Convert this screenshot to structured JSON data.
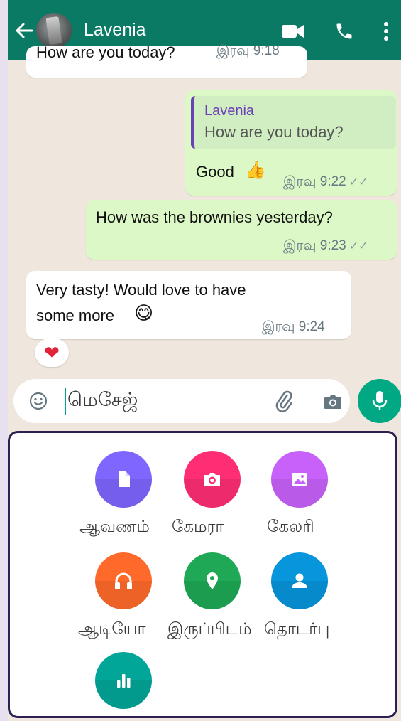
{
  "header": {
    "contact_name": "Lavenia",
    "icons": [
      "back-arrow-icon",
      "avatar",
      "video-call-icon",
      "voice-call-icon",
      "more-options-icon"
    ]
  },
  "messages": [
    {
      "direction": "in",
      "text": "How are you today?",
      "time": "இரவு 9:18"
    },
    {
      "direction": "out",
      "quote": {
        "name": "Lavenia",
        "text": "How are you today?"
      },
      "text": "Good",
      "emoji": "👍",
      "time": "இரவு 9:22"
    },
    {
      "direction": "out",
      "text": "How was the brownies yesterday?",
      "time": "இரவு 9:23"
    },
    {
      "direction": "in",
      "text_line1": "Very tasty! Would love to have",
      "text_line2": "some more",
      "emoji": "😋",
      "time": "இரவு 9:24",
      "reaction": "❤"
    }
  ],
  "composer": {
    "placeholder": "மெசேஜ்",
    "icons": [
      "emoji-icon",
      "attach-icon",
      "camera-icon",
      "mic-icon"
    ]
  },
  "attach_menu": {
    "items": [
      {
        "label": "ஆவணம்",
        "icon": "document-icon",
        "color": "#7f66ff"
      },
      {
        "label": "கேமரா",
        "icon": "camera-icon",
        "color": "#ff2e74"
      },
      {
        "label": "கேலரி",
        "icon": "gallery-icon",
        "color": "#c861fa"
      },
      {
        "label": "ஆடியோ",
        "icon": "headphones-icon",
        "color": "#ff6a2a"
      },
      {
        "label": "இருப்பிடம்",
        "icon": "location-icon",
        "color": "#1fa855"
      },
      {
        "label": "தொடர்பு",
        "icon": "contact-icon",
        "color": "#0795dc"
      },
      {
        "label": "",
        "icon": "poll-icon",
        "color": "#02a698"
      }
    ]
  },
  "colors": {
    "header": "#0b7a64",
    "outgoing_bubble": "#dcf8c6",
    "incoming_bubble": "#ffffff",
    "accent": "#00a884"
  }
}
